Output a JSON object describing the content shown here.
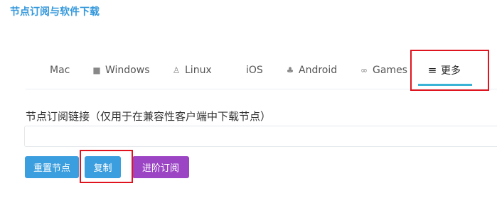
{
  "page": {
    "title": "节点订阅与软件下载"
  },
  "tabs": [
    {
      "label": "Mac",
      "icon": "apple-icon"
    },
    {
      "label": "Windows",
      "icon": "windows-icon"
    },
    {
      "label": "Linux",
      "icon": "linux-icon"
    },
    {
      "label": "iOS",
      "icon": "apple-icon"
    },
    {
      "label": "Android",
      "icon": "android-icon"
    },
    {
      "label": "Games",
      "icon": "gamepad-icon"
    },
    {
      "label": "更多",
      "icon": "menu-icon",
      "active": true
    }
  ],
  "subscription": {
    "label": "节点订阅链接（仅用于在兼容性客户端中下载节点）",
    "value": ""
  },
  "buttons": {
    "reset": "重置节点",
    "copy": "复制",
    "upgrade": "进阶订阅"
  },
  "colors": {
    "accent": "#3b9ede",
    "title": "#3498db",
    "upgrade": "#9b45c4",
    "highlight": "#e0141e",
    "tab_underline": "#3bb3d6"
  }
}
